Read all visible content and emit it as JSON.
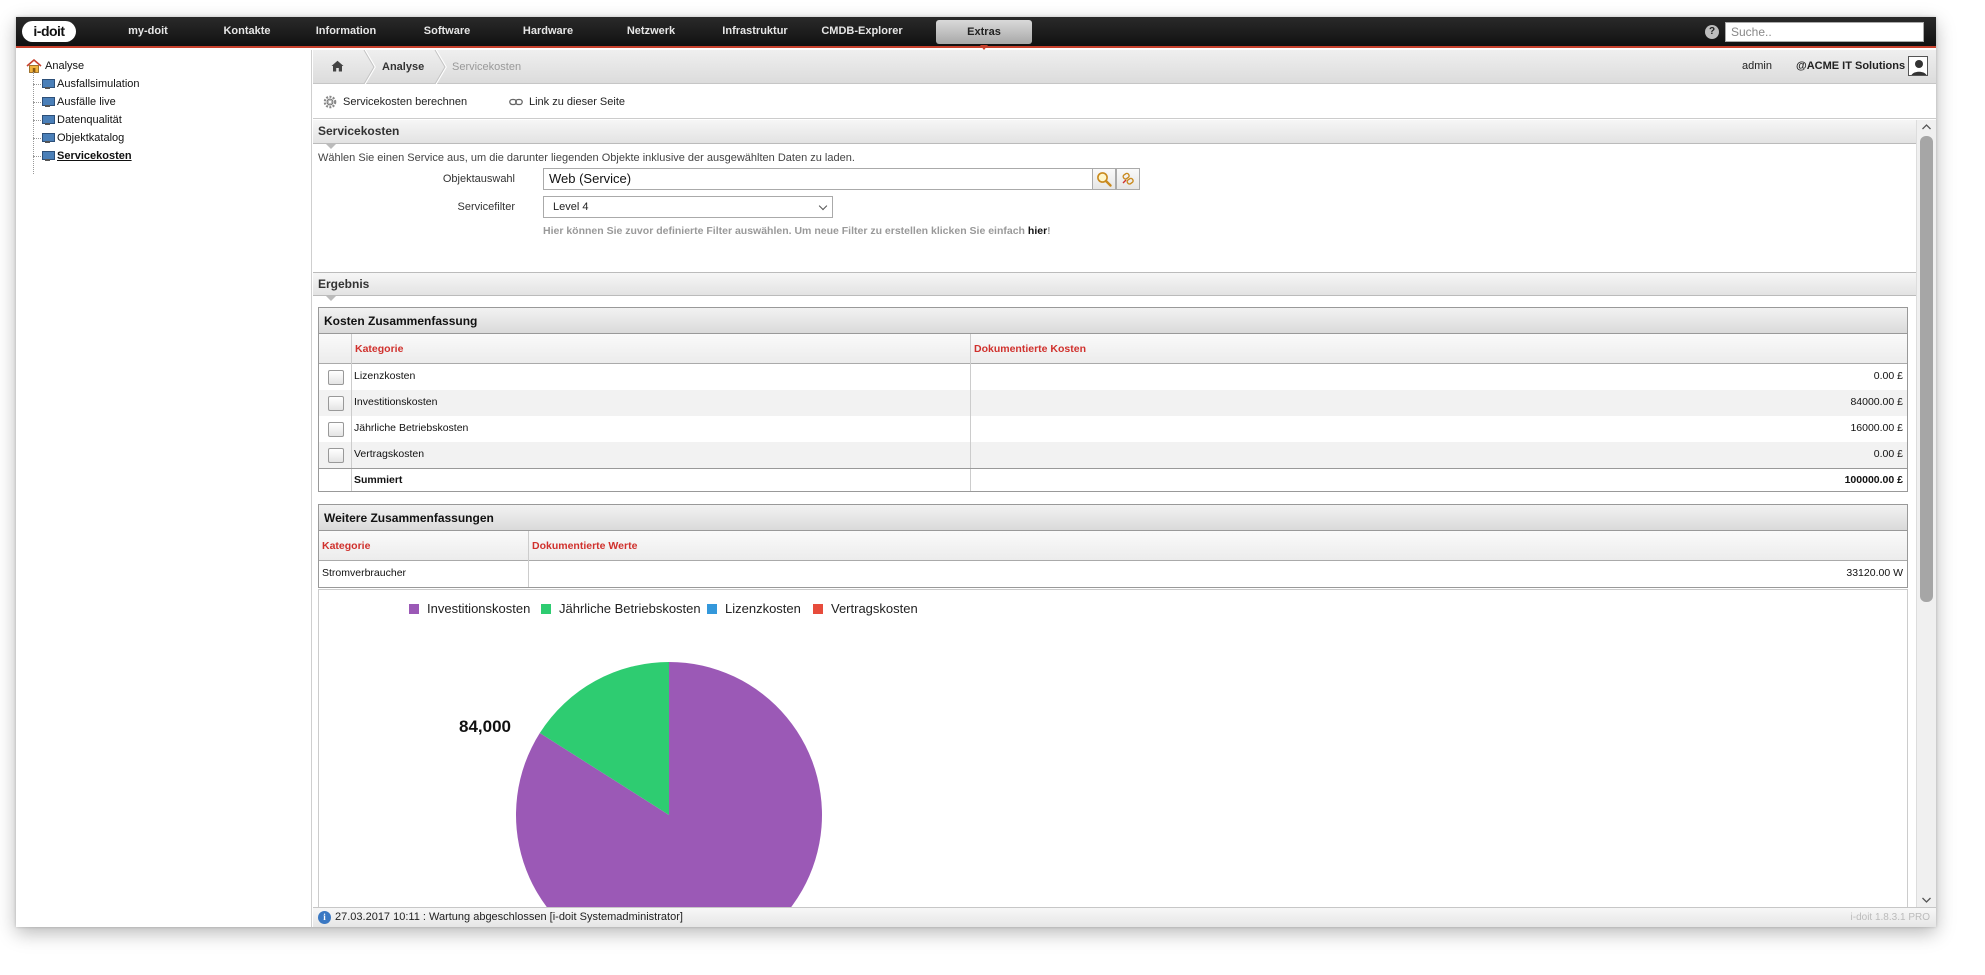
{
  "app": {
    "logo": "i-doit"
  },
  "nav": {
    "items": [
      {
        "label": "my-doit"
      },
      {
        "label": "Kontakte"
      },
      {
        "label": "Information"
      },
      {
        "label": "Software"
      },
      {
        "label": "Hardware"
      },
      {
        "label": "Netzwerk"
      },
      {
        "label": "Infrastruktur"
      },
      {
        "label": "CMDB-Explorer"
      },
      {
        "label": "Extras",
        "active": true
      }
    ],
    "search_placeholder": "Suche.."
  },
  "sidebar": {
    "root": "Analyse",
    "items": [
      {
        "label": "Ausfallsimulation"
      },
      {
        "label": "Ausfälle live"
      },
      {
        "label": "Datenqualität"
      },
      {
        "label": "Objektkatalog"
      },
      {
        "label": "Servicekosten",
        "active": true
      }
    ]
  },
  "breadcrumb": {
    "parent": "Analyse",
    "current": "Servicekosten"
  },
  "user": {
    "name": "admin",
    "company": "@ACME IT Solutions"
  },
  "actions": {
    "calculate": "Servicekosten berechnen",
    "link": "Link zu dieser Seite"
  },
  "servicecost": {
    "title": "Servicekosten",
    "intro": "Wählen Sie einen Service aus, um die darunter liegenden Objekte inklusive der ausgewählten Daten zu laden.",
    "object_label": "Objektauswahl",
    "object_value": "Web (Service)",
    "filter_label": "Servicefilter",
    "filter_value": "Level 4",
    "hint_text": "Hier können Sie zuvor definierte Filter auswählen. Um neue Filter zu erstellen klicken Sie einfach ",
    "hint_link": "hier",
    "hint_end": "!"
  },
  "result": {
    "title": "Ergebnis",
    "summary": {
      "title": "Kosten Zusammenfassung",
      "col_category": "Kategorie",
      "col_costs": "Dokumentierte Kosten",
      "rows": [
        {
          "category": "Lizenzkosten",
          "value": "0.00 £"
        },
        {
          "category": "Investitionskosten",
          "value": "84000.00 £"
        },
        {
          "category": "Jährliche Betriebskosten",
          "value": "16000.00 £"
        },
        {
          "category": "Vertragskosten",
          "value": "0.00 £"
        }
      ],
      "total_label": "Summiert",
      "total_value": "100000.00 £"
    },
    "further": {
      "title": "Weitere Zusammenfassungen",
      "col_category": "Kategorie",
      "col_values": "Dokumentierte Werte",
      "rows": [
        {
          "category": "Stromverbraucher",
          "value": "33120.00 W"
        }
      ]
    }
  },
  "chart_data": {
    "type": "pie",
    "categories": [
      "Investitionskosten",
      "Jährliche Betriebskosten",
      "Lizenzkosten",
      "Vertragskosten"
    ],
    "values": [
      84000,
      16000,
      0,
      0
    ],
    "colors": [
      "#9b59b6",
      "#2ecc71",
      "#3498db",
      "#e74c3c"
    ],
    "data_labels": [
      "84,000"
    ],
    "legend": "top-left"
  },
  "status": {
    "message": "27.03.2017 10:11 : Wartung abgeschlossen [i-doit Systemadministrator]",
    "version": "i-doit 1.8.3.1 PRO"
  }
}
